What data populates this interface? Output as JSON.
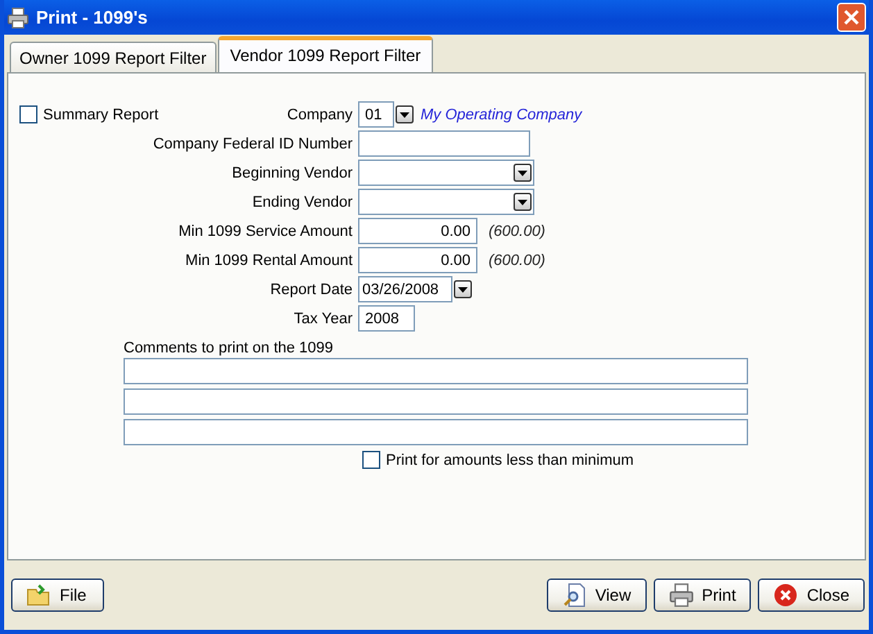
{
  "window": {
    "title": "Print - 1099's"
  },
  "tabs": [
    {
      "label": "Owner 1099 Report Filter",
      "selected": false
    },
    {
      "label": "Vendor 1099 Report Filter",
      "selected": true
    }
  ],
  "summary_report": {
    "label": "Summary Report",
    "checked": false
  },
  "fields": [
    {
      "kind": "combo",
      "label": "Company",
      "value": "01",
      "note": "My Operating Company"
    },
    {
      "kind": "text",
      "label": "Company Federal ID Number"
    },
    {
      "kind": "dropdown",
      "label": "Beginning Vendor"
    },
    {
      "kind": "dropdown",
      "label": "Ending Vendor"
    },
    {
      "kind": "amount",
      "label": "Min 1099 Service Amount",
      "value": "0.00",
      "hint": "(600.00)"
    },
    {
      "kind": "amount",
      "label": "Min 1099 Rental Amount",
      "value": "0.00",
      "hint": "(600.00)"
    },
    {
      "kind": "date",
      "label": "Report Date",
      "value": "03/26/2008"
    },
    {
      "kind": "year",
      "label": "Tax Year",
      "value": "2008"
    }
  ],
  "comments": {
    "label": "Comments to print on the 1099",
    "lines": [
      {
        "kind": "text"
      },
      {
        "kind": "text"
      },
      {
        "kind": "text"
      }
    ]
  },
  "print_less_than_minimum": {
    "label": "Print for amounts less than minimum",
    "checked": false
  },
  "buttons": [
    {
      "kind": "file",
      "label": "File"
    },
    {
      "kind": "view",
      "label": "View"
    },
    {
      "kind": "print",
      "label": "Print"
    },
    {
      "kind": "close",
      "label": "Close"
    }
  ]
}
